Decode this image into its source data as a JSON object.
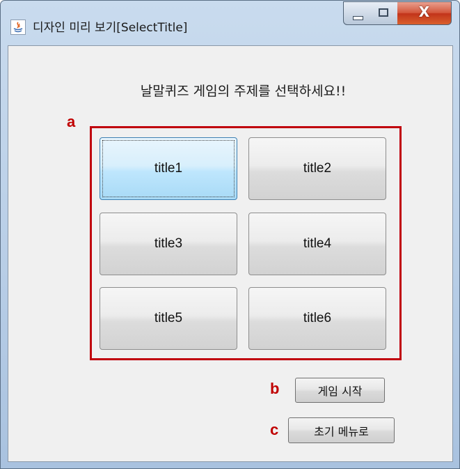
{
  "window": {
    "title": "디자인 미리 보기[SelectTitle]",
    "close_glyph": "X",
    "icons": [
      "java-app-icon",
      "minimize-icon",
      "maximize-icon",
      "close-icon"
    ]
  },
  "prompt": "날말퀴즈 게임의 주제를 선택하세요!!",
  "annotations": {
    "a": "a",
    "b": "b",
    "c": "c",
    "color": "#c00000"
  },
  "titles": [
    {
      "label": "title1",
      "selected": true
    },
    {
      "label": "title2",
      "selected": false
    },
    {
      "label": "title3",
      "selected": false
    },
    {
      "label": "title4",
      "selected": false
    },
    {
      "label": "title5",
      "selected": false
    },
    {
      "label": "title6",
      "selected": false
    }
  ],
  "buttons": {
    "start_game": "게임 시작",
    "initial_menu": "초기 메뉴로"
  }
}
